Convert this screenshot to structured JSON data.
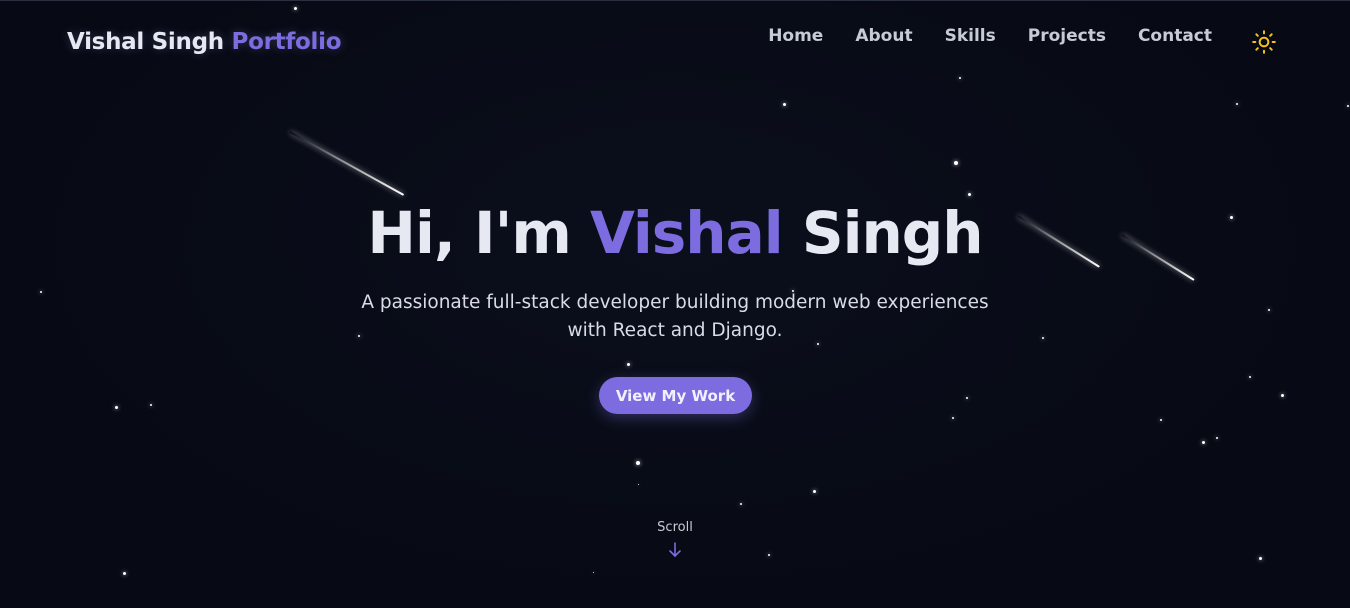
{
  "brand": {
    "name": "Vishal Singh",
    "accent": "Portfolio"
  },
  "nav": {
    "items": [
      "Home",
      "About",
      "Skills",
      "Projects",
      "Contact"
    ],
    "theme_toggle_icon": "sun-icon"
  },
  "hero": {
    "greeting": "Hi, I'm",
    "first_name": "Vishal",
    "last_name": "Singh",
    "subtitle": "A passionate full-stack developer building modern web experiences with React and Django.",
    "cta_label": "View My Work"
  },
  "scroll": {
    "label": "Scroll",
    "icon": "arrow-down-icon"
  },
  "colors": {
    "background": "#070a14",
    "accent": "#7c6ce0",
    "text": "#e6e9f2",
    "sun": "#f5c518"
  }
}
